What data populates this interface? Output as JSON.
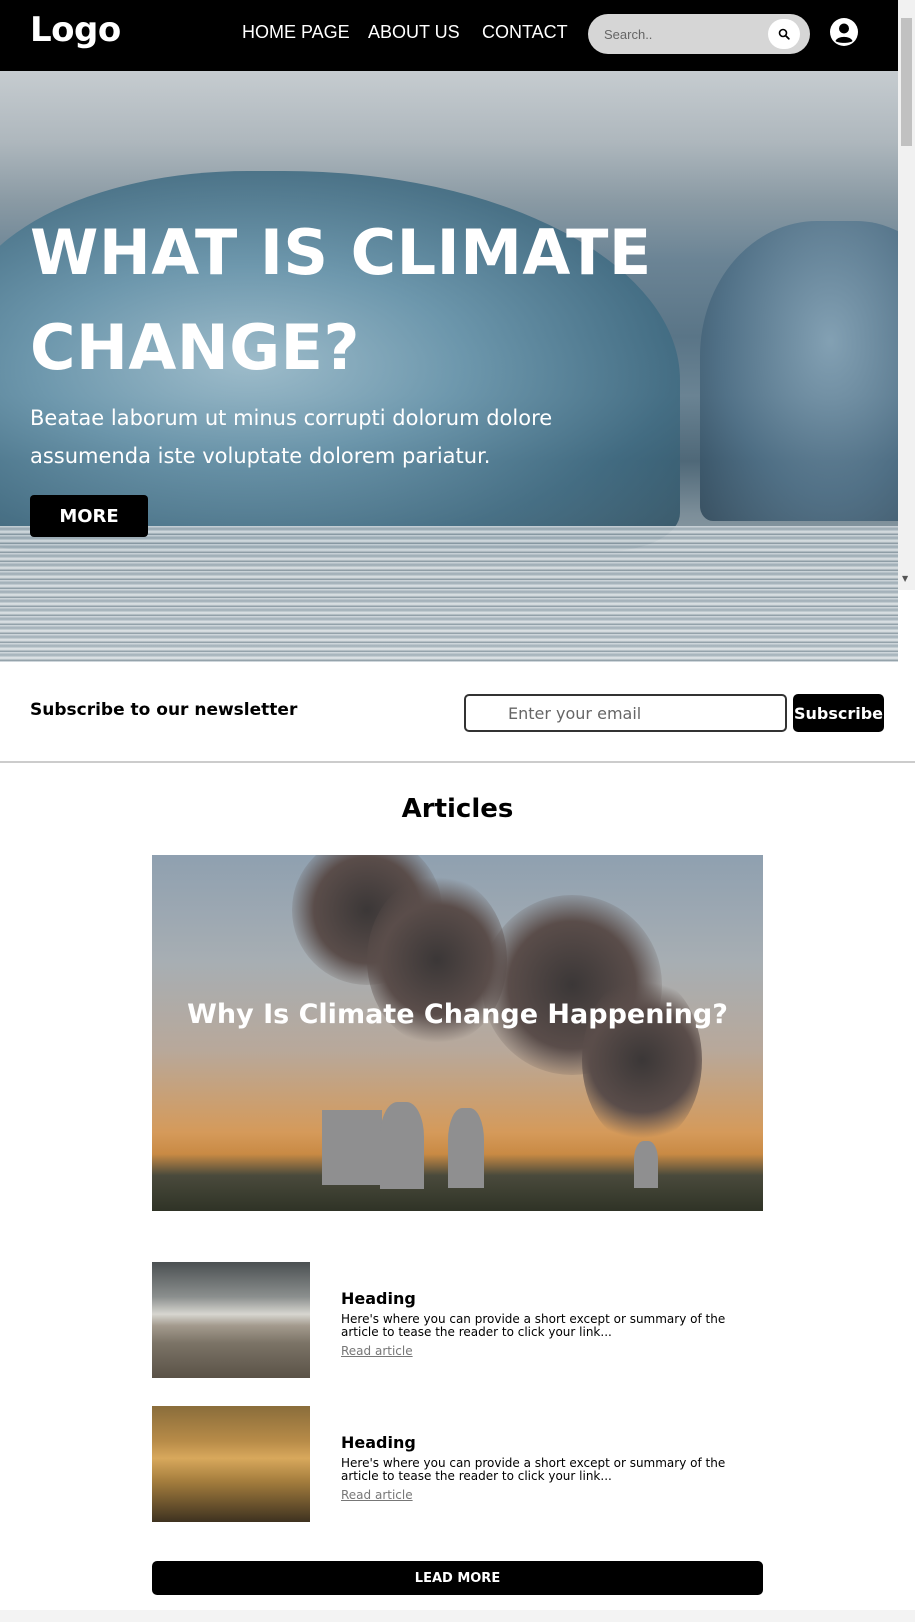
{
  "nav": {
    "logo": "Logo",
    "links": [
      "HOME PAGE",
      "ABOUT US",
      "CONTACT"
    ],
    "search_placeholder": "Search..",
    "search_icon": "search-icon",
    "account_icon": "user-circle-icon"
  },
  "hero": {
    "title": "WHAT IS CLIMATE CHANGE?",
    "text": "Beatae laborum ut minus corrupti dolorum dolore assumenda iste voluptate dolorem pariatur.",
    "button": "MORE"
  },
  "newsletter": {
    "title": "Subscribe to our newsletter",
    "placeholder": "Enter your email",
    "button": "Subscribe"
  },
  "articles": {
    "title": "Articles",
    "feature_title": "Why Is Climate Change Happening?",
    "cards": [
      {
        "heading": "Heading",
        "text": "Here's where you can provide a short except or summary of the article to tease the reader to click your link...",
        "link": "Read article"
      },
      {
        "heading": "Heading",
        "text": "Here's where you can provide a short except or summary of the article to tease the reader to click your link...",
        "link": "Read article"
      }
    ],
    "more_button": "LEAD MORE"
  },
  "colors": {
    "nav_bg": "#000000",
    "accent": "#000000",
    "link_muted": "#777777"
  }
}
